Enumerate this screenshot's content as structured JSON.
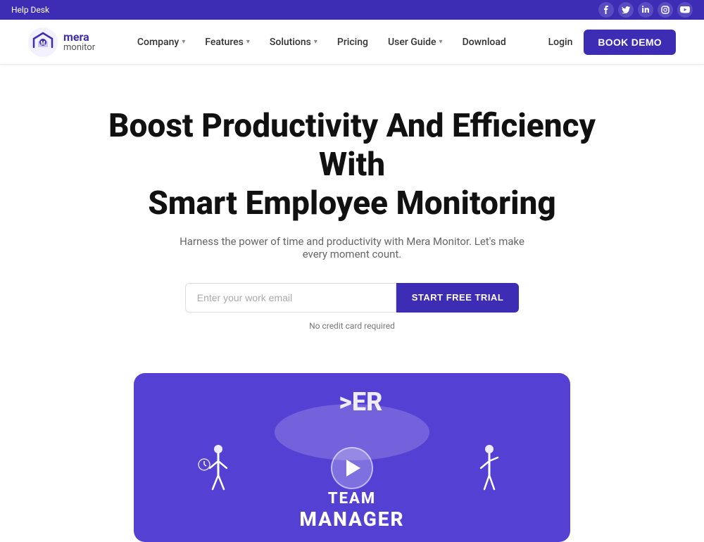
{
  "topbar": {
    "help_desk_label": "Help Desk",
    "social": [
      {
        "name": "facebook",
        "icon": "f"
      },
      {
        "name": "twitter",
        "icon": "t"
      },
      {
        "name": "linkedin",
        "icon": "in"
      },
      {
        "name": "instagram",
        "icon": "ig"
      },
      {
        "name": "youtube",
        "icon": "▶"
      }
    ]
  },
  "navbar": {
    "logo": {
      "mera": "mera",
      "monitor": "monitor"
    },
    "links": [
      {
        "label": "Company",
        "has_dropdown": true
      },
      {
        "label": "Features",
        "has_dropdown": true
      },
      {
        "label": "Solutions",
        "has_dropdown": true
      },
      {
        "label": "Pricing",
        "has_dropdown": false
      },
      {
        "label": "User Guide",
        "has_dropdown": true
      },
      {
        "label": "Download",
        "has_dropdown": false
      }
    ],
    "login_label": "Login",
    "book_demo_label": "BOOK DEMO"
  },
  "hero": {
    "title_line1": "Boost Productivity And Efficiency With",
    "title_line2": "Smart Employee Monitoring",
    "subtitle": "Harness the power of time and productivity with Mera Monitor. Let's make every moment count.",
    "email_placeholder": "Enter your work email",
    "cta_button_label": "START FREE TRIAL",
    "no_credit_card_text": "No credit card required"
  },
  "video": {
    "partial_text": "ER",
    "team_label": "TEAM",
    "manager_label": "MANAGER"
  },
  "colors": {
    "brand_purple": "#3d2db5",
    "video_bg": "#5540d4",
    "topbar_bg": "#3d2db5"
  }
}
